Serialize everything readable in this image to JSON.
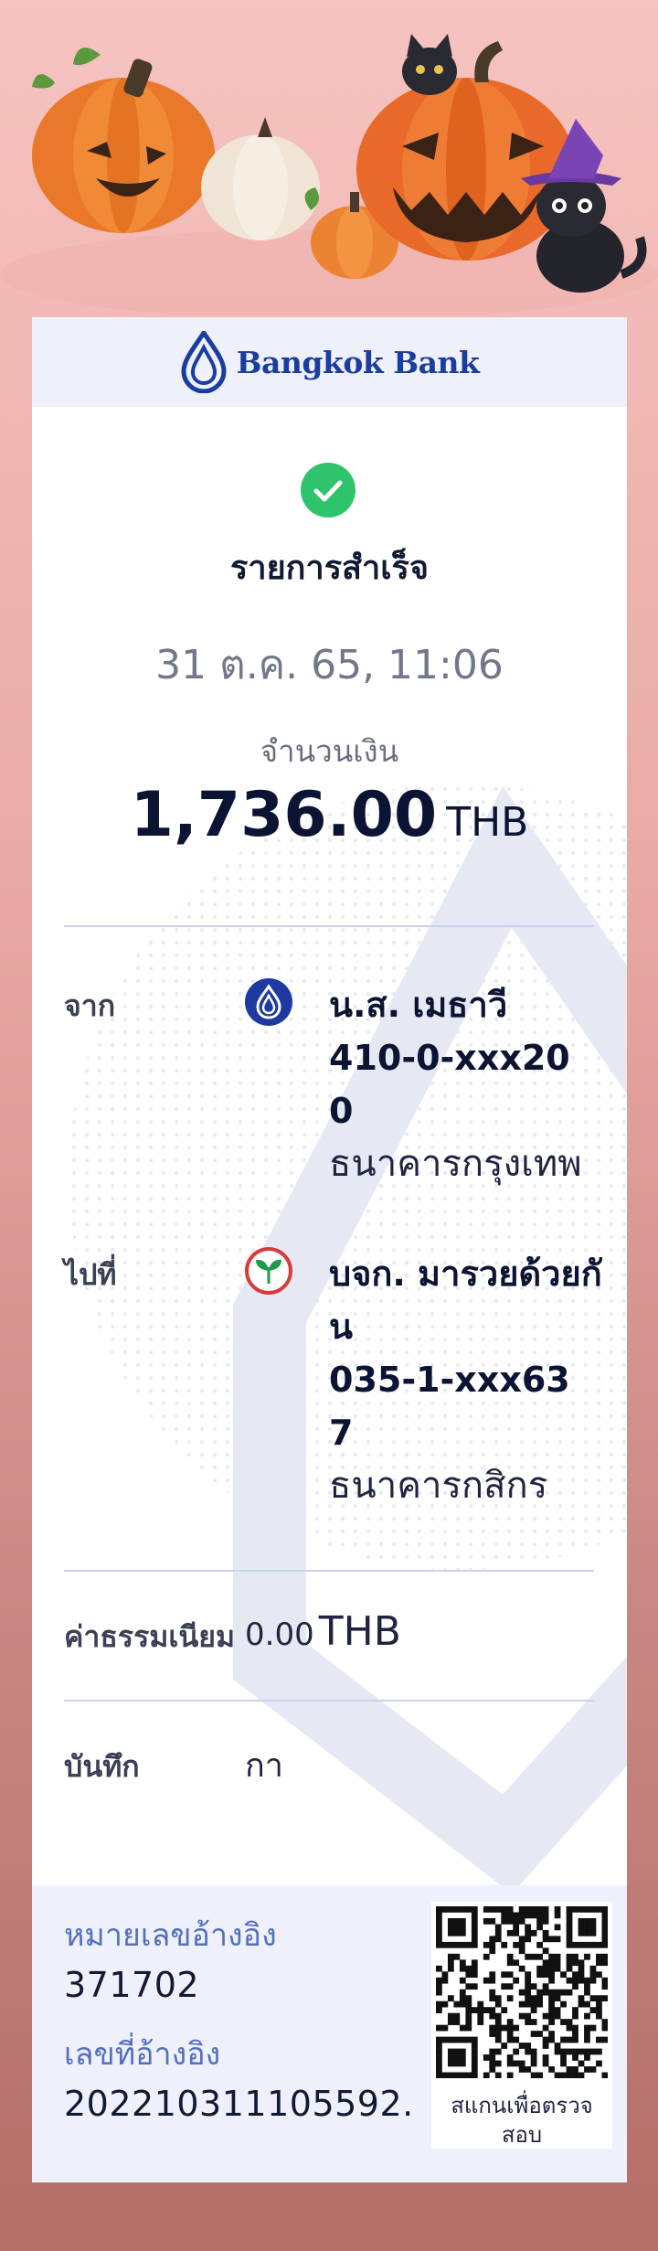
{
  "brand": {
    "name": "Bangkok Bank",
    "color": "#1b3da0"
  },
  "status": {
    "title": "รายการสำเร็จ",
    "icon": "check-circle-icon",
    "color": "#2fc46b"
  },
  "datetime": "31 ต.ค. 65, 11:06",
  "amount": {
    "label": "จำนวนเงิน",
    "value": "1,736.00",
    "currency": "THB"
  },
  "from": {
    "label": "จาก",
    "icon": "bangkok-bank-logo-icon",
    "name": "น.ส. เมธาวี",
    "account": "410-0-xxx200",
    "bank": "ธนาคารกรุงเทพ"
  },
  "to": {
    "label": "ไปที่",
    "icon": "kasikorn-bank-logo-icon",
    "name": "บจก. มารวยด้วยกัน",
    "account": "035-1-xxx637",
    "bank": "ธนาคารกสิกร"
  },
  "fee": {
    "label": "ค่าธรรมเนียม",
    "value": "0.00",
    "currency": "THB"
  },
  "memo": {
    "label": "บันทึก",
    "value": "กา"
  },
  "reference": {
    "label1": "หมายเลขอ้างอิง",
    "value1": "371702",
    "label2": "เลขที่อ้างอิง",
    "value2": "202210311105592.",
    "qr_caption": "สแกนเพื่อตรวจสอบ",
    "qr_icon": "qr-code-icon"
  },
  "decoration": {
    "theme": "halloween-pumpkins-cats-illustration"
  }
}
